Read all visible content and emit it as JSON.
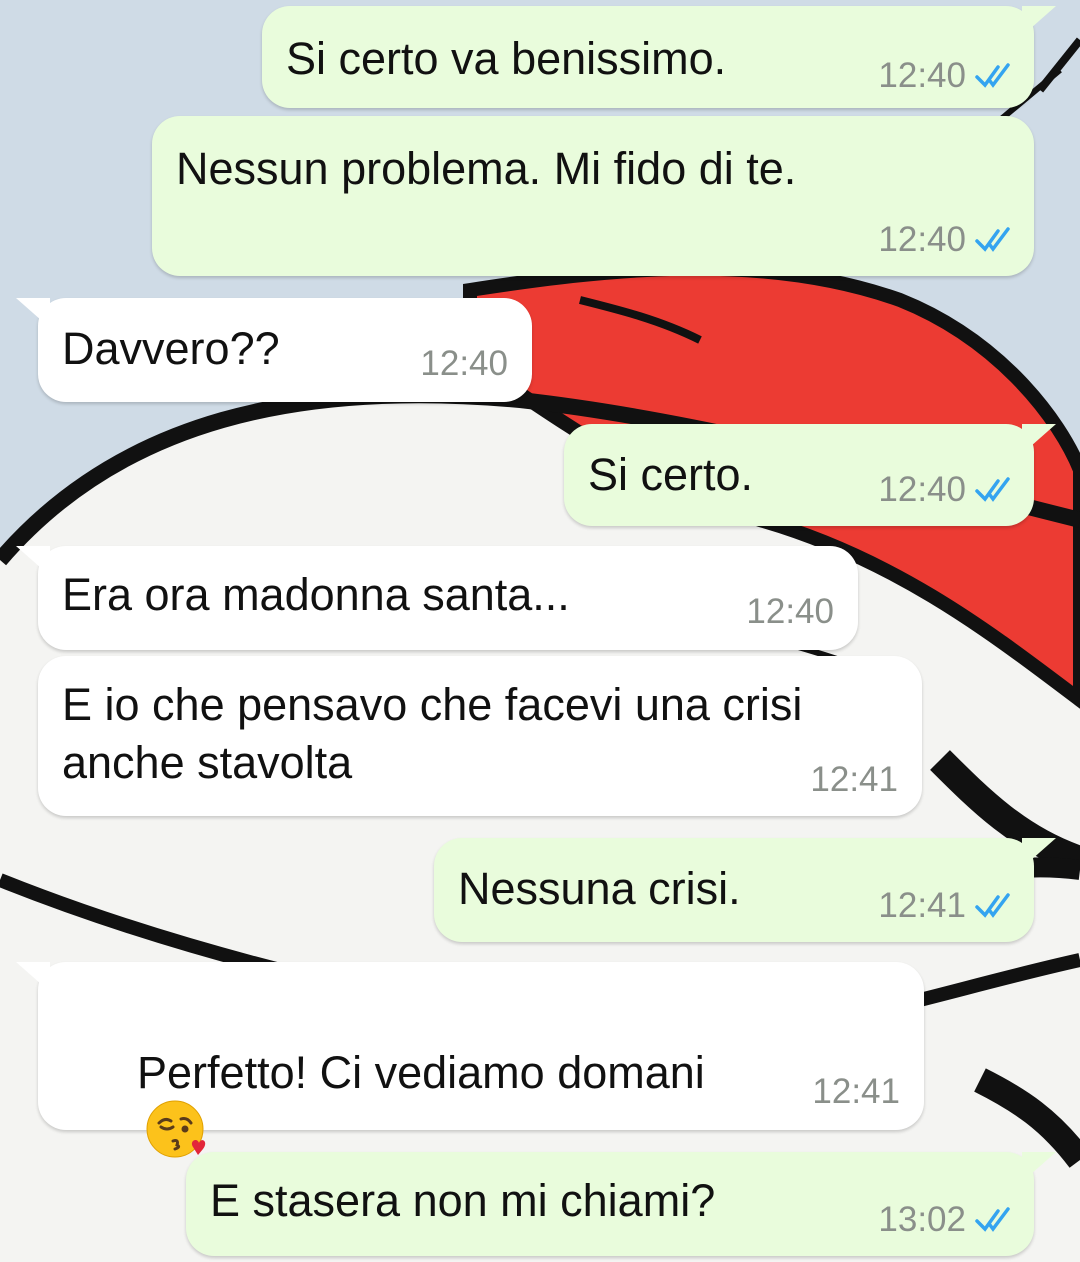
{
  "theme": {
    "outgoing_bubble": "#e9fcdc",
    "incoming_bubble": "#ffffff",
    "timestamp_color": "#8a8f8a",
    "read_tick_color": "#34a4f0"
  },
  "messages": [
    {
      "direction": "out",
      "text": "Si certo va benissimo.",
      "time": "12:40",
      "status": "read-ticks-icon"
    },
    {
      "direction": "out",
      "text": "Nessun problema. Mi fido di te.",
      "time": "12:40",
      "status": "read-ticks-icon"
    },
    {
      "direction": "in",
      "text": "Davvero??",
      "time": "12:40"
    },
    {
      "direction": "out",
      "text": "Si certo.",
      "time": "12:40",
      "status": "read-ticks-icon"
    },
    {
      "direction": "in",
      "text": "Era ora madonna santa...",
      "time": "12:40"
    },
    {
      "direction": "in",
      "text_lines": [
        "E io che pensavo che facevi una crisi",
        "anche stavolta"
      ],
      "time": "12:41"
    },
    {
      "direction": "out",
      "text": "Nessuna crisi.",
      "time": "12:41",
      "status": "read-ticks-icon"
    },
    {
      "direction": "in",
      "text": "Perfetto! Ci vediamo domani",
      "emoji": "kissing-face-emoji",
      "time": "12:41"
    },
    {
      "direction": "out",
      "text": "E stasera non mi chiami?",
      "time": "13:02",
      "status": "read-ticks-icon"
    }
  ]
}
